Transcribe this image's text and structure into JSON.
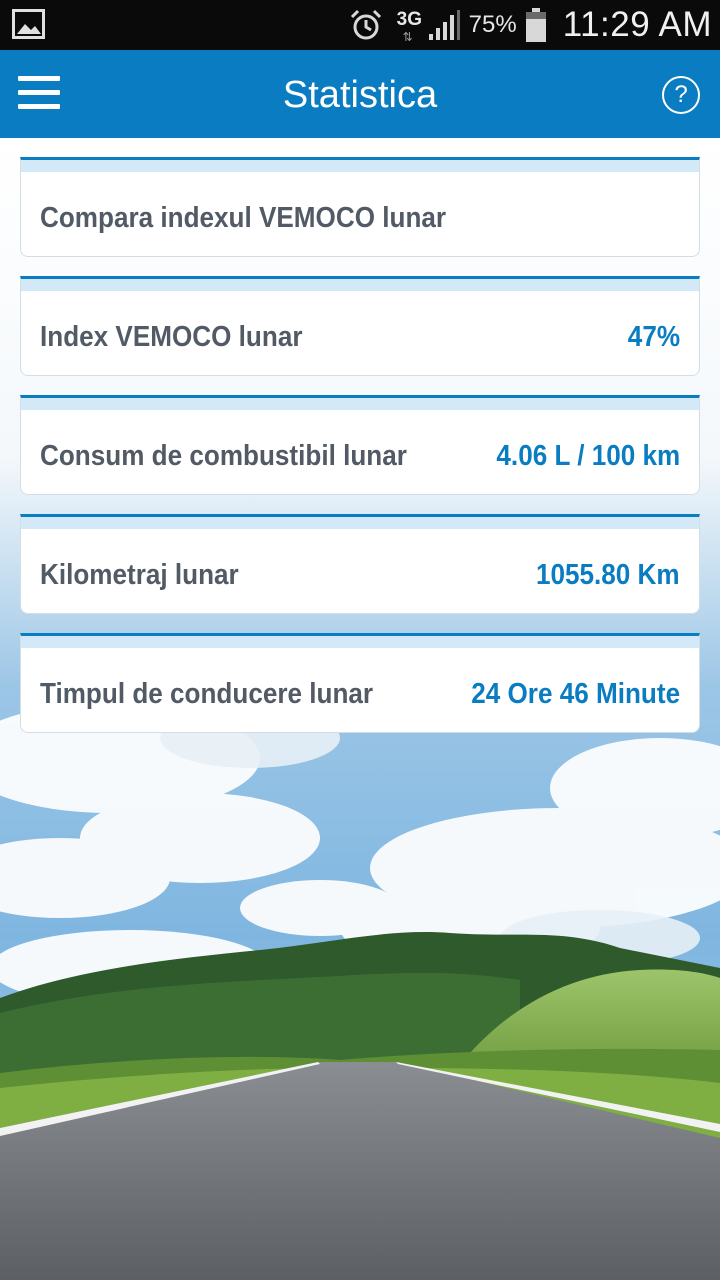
{
  "status_bar": {
    "network": "3G",
    "battery_percent": "75%",
    "time": "11:29 AM",
    "icons": [
      "gallery-icon",
      "alarm-icon",
      "data-arrows-icon",
      "signal-icon",
      "battery-icon"
    ]
  },
  "header": {
    "title": "Statistica",
    "menu_icon": "hamburger-menu-icon",
    "help_label": "?"
  },
  "stats": [
    {
      "label": "Compara indexul VEMOCO lunar",
      "value": ""
    },
    {
      "label": "Index VEMOCO lunar",
      "value": "47%"
    },
    {
      "label": "Consum de combustibil lunar",
      "value": "4.06 L / 100 km"
    },
    {
      "label": "Kilometraj lunar",
      "value": "1055.80 Km"
    },
    {
      "label": "Timpul de conducere lunar",
      "value": "24 Ore 46 Minute"
    }
  ],
  "colors": {
    "accent": "#0a7cc2",
    "label_text": "#525a66",
    "card_stripe": "#d4e9f7",
    "status_bar": "#0a0a0a"
  }
}
